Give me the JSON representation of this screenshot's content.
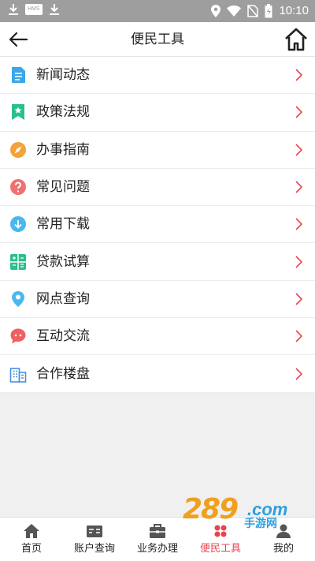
{
  "status_bar": {
    "time": "10:10",
    "hms_badge": "HMS"
  },
  "header": {
    "title": "便民工具"
  },
  "menu": {
    "items": [
      {
        "label": "新闻动态",
        "icon": "news-document-icon",
        "color": "#3aa8e8"
      },
      {
        "label": "政策法规",
        "icon": "policy-bookmark-icon",
        "color": "#2bbf8f"
      },
      {
        "label": "办事指南",
        "icon": "compass-guide-icon",
        "color": "#f4a23a"
      },
      {
        "label": "常见问题",
        "icon": "question-icon",
        "color": "#f07070"
      },
      {
        "label": "常用下载",
        "icon": "download-icon",
        "color": "#4ab8ee"
      },
      {
        "label": "贷款试算",
        "icon": "calculator-icon",
        "color": "#2bbf8f"
      },
      {
        "label": "网点查询",
        "icon": "location-pin-icon",
        "color": "#4ab8ee"
      },
      {
        "label": "互动交流",
        "icon": "chat-bubble-icon",
        "color": "#f06060"
      },
      {
        "label": "合作楼盘",
        "icon": "buildings-icon",
        "color": "#4a8fe0"
      }
    ],
    "chevron_color": "#e8434f"
  },
  "tabs": [
    {
      "label": "首页",
      "icon": "home-tab-icon",
      "active": false
    },
    {
      "label": "账户查询",
      "icon": "account-card-icon",
      "active": false
    },
    {
      "label": "业务办理",
      "icon": "briefcase-icon",
      "active": false
    },
    {
      "label": "便民工具",
      "icon": "tools-grid-icon",
      "active": true
    },
    {
      "label": "我的",
      "icon": "profile-icon",
      "active": false
    }
  ],
  "watermark": {
    "number": "289",
    "domain": ".com",
    "subtitle": "手游网"
  },
  "colors": {
    "accent": "#e8434f",
    "status_bar": "#9e9e9e",
    "background": "#f0f0f0"
  }
}
